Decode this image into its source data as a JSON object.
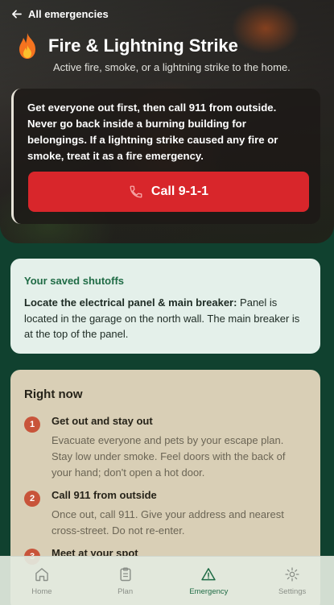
{
  "header": {
    "back_label": "All emergencies",
    "title": "Fire & Lightning Strike",
    "subtitle": "Active fire, smoke, or a lightning strike to the home."
  },
  "alert": {
    "message": "Get everyone out first, then call 911 from outside. Never go back inside a burning building for belongings. If a lightning strike caused any fire or smoke, treat it as a fire emergency.",
    "call_label": "Call 9-1-1"
  },
  "shutoffs": {
    "heading": "Your saved shutoffs",
    "item_label": "Locate the electrical panel & main breaker:",
    "item_text": " Panel is located in the garage on the north wall. The main breaker is at the top of the panel."
  },
  "right_now": {
    "heading": "Right now",
    "steps": [
      {
        "num": "1",
        "title": "Get out and stay out",
        "desc": "Evacuate everyone and pets by your escape plan. Stay low under smoke. Feel doors with the back of your hand; don't open a hot door."
      },
      {
        "num": "2",
        "title": "Call 911 from outside",
        "desc": "Once out, call 911. Give your address and nearest cross-street. Do not re-enter."
      },
      {
        "num": "3",
        "title": "Meet at your spot",
        "desc": ""
      }
    ]
  },
  "nav": {
    "items": [
      {
        "label": "Home",
        "icon": "home-icon"
      },
      {
        "label": "Plan",
        "icon": "clipboard-icon"
      },
      {
        "label": "Emergency",
        "icon": "warning-triangle-icon"
      },
      {
        "label": "Settings",
        "icon": "gear-icon"
      }
    ],
    "active": "Emergency"
  },
  "colors": {
    "call_button": "#d8262b",
    "accent_green": "#1f6b45",
    "step_badge": "#c8543a",
    "background": "#10412f"
  }
}
